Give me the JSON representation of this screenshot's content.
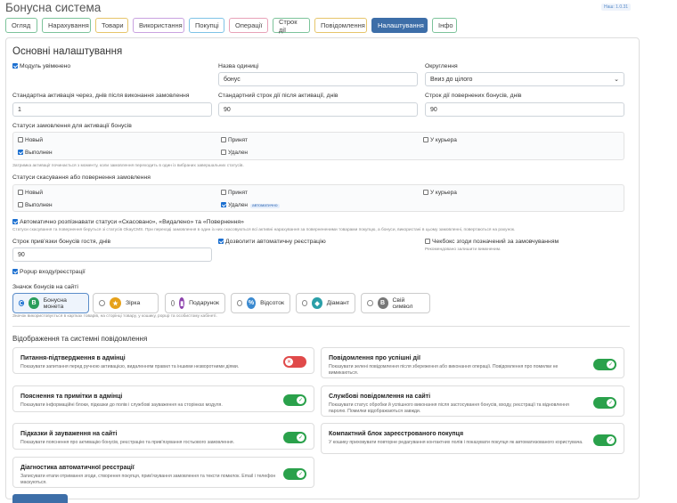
{
  "app": {
    "title": "Бонусна система",
    "version": "Наш: 1.0.31"
  },
  "tabs": [
    {
      "label": "Огляд",
      "color": "#7cc39a"
    },
    {
      "label": "Нарахування",
      "color": "#7cc39a"
    },
    {
      "label": "Товари",
      "color": "#e6c56a"
    },
    {
      "label": "Використання",
      "color": "#c9a2e0"
    },
    {
      "label": "Покупці",
      "color": "#7fc3e6"
    },
    {
      "label": "Операції",
      "color": "#e8a2b8"
    },
    {
      "label": "Строк дії",
      "color": "#7cc39a"
    },
    {
      "label": "Повідомлення",
      "color": "#e6c56a"
    },
    {
      "label": "Налаштування",
      "color": "#3d6ea8"
    },
    {
      "label": "Інфо",
      "color": "#7cc39a"
    }
  ],
  "settings": {
    "title": "Основні налаштування",
    "module_enabled": "Модуль увімкнено",
    "unit_name_label": "Назва одиниці",
    "unit_name_value": "бонус",
    "rounding_label": "Округлення",
    "rounding_value": "Вниз до цілого",
    "activation_label": "Стандартна активація через, днів після виконання замовлення",
    "activation_value": "1",
    "validity_label": "Стандартний строк дії після активації, днів",
    "validity_value": "90",
    "returned_label": "Строк дії повернених бонусів, днів",
    "returned_value": "90",
    "activation_statuses_label": "Статуси замовлення для активації бонусів",
    "activation_statuses": {
      "new": "Новый",
      "accepted": "Принят",
      "courier": "У курьера",
      "done": "Выполнен",
      "deleted": "Удален"
    },
    "activation_hint": "Затримка активації починається з моменту, коли замовлення переходить в один із вибраних завершальних статусів.",
    "cancel_statuses_label": "Статуси скасування або повернення замовлення",
    "cancel_statuses": {
      "new": "Новый",
      "accepted": "Принят",
      "courier": "У курьера",
      "done": "Выполнен",
      "deleted": "Удален",
      "badge": "автоматично"
    },
    "auto_recognize": "Автоматично розпізнавати статуси «Скасовано», «Видалено» та «Повернення»",
    "auto_recognize_hint": "Статуси скасування та повернення беруться зі статусів OkayCMS. При переході замовлення в один із них скасовуються всі активні нарахування за повернененими товарами покупцю, а бонуси, використані в цьому замовленні, повертаються на рахунок.",
    "guest_bind_label": "Строк прив'язки бонусів гостя, днів",
    "guest_bind_value": "90",
    "auto_register": "Дозволити автоматичну реєстрацію",
    "consent_checkbox": "Чекбокс згоди позначений за замовчуванням",
    "consent_hint": "Рекомендовано залишити вимкненим.",
    "popup": "Popup входу/реєстрації",
    "icon_label": "Значок бонусів на сайті",
    "icons": [
      {
        "label": "Бонусна монета",
        "glyph": "B",
        "color": "#2a9d5b"
      },
      {
        "label": "Зірка",
        "glyph": "★",
        "color": "#e6a11a"
      },
      {
        "label": "Подарунок",
        "glyph": "▮",
        "color": "#8e44ad"
      },
      {
        "label": "Відсоток",
        "glyph": "%",
        "color": "#3b8ad0"
      },
      {
        "label": "Діамант",
        "glyph": "◆",
        "color": "#2a9fa8"
      },
      {
        "label": "Свій символ",
        "glyph": "B",
        "color": "#777777"
      }
    ],
    "icon_hint": "Значок використовується в картках товарів, на сторінці товару, у кошику, popup та особистому кабінеті."
  },
  "display": {
    "title": "Відображення та системні повідомлення",
    "cards": [
      {
        "title": "Питання-підтвердження в адмінці",
        "desc": "Показувати запитання перед ручною активацією, видаленням правил та іншими незворотними діями.",
        "state": "off"
      },
      {
        "title": "Повідомлення про успішні дії",
        "desc": "Показувати зелені повідомлення після збереження або виконання операції. Повідомлення про помилки не вимикаються.",
        "state": "on"
      },
      {
        "title": "Пояснення та примітки в адмінці",
        "desc": "Показувати інформаційні блоки, підказки до полів і службові зауваження на сторінках модуля.",
        "state": "on"
      },
      {
        "title": "Службові повідомлення на сайті",
        "desc": "Показувати статус обробки й успішного виконання після застосування бонусів, входу, реєстрації та відновлення паролю. Помилки відображаються завжди.",
        "state": "on"
      },
      {
        "title": "Підказки й зауваження на сайті",
        "desc": "Показувати пояснення про активацію бонусів, реєстрацію та прив'язування гостьового замовлення.",
        "state": "on"
      },
      {
        "title": "Компактний блок зареєстрованого покупця",
        "desc": "У кошику приховувати повторне редагування контактних полів і показувати покупця як автоматизованого користувача.",
        "state": "on"
      },
      {
        "title": "Діагностика автоматичної реєстрації",
        "desc": "Записувати етапи отримання згоди, створення покупця, прив'язування замовлення та тексти помилок. Email і телефон маскуються.",
        "state": "on"
      }
    ]
  }
}
